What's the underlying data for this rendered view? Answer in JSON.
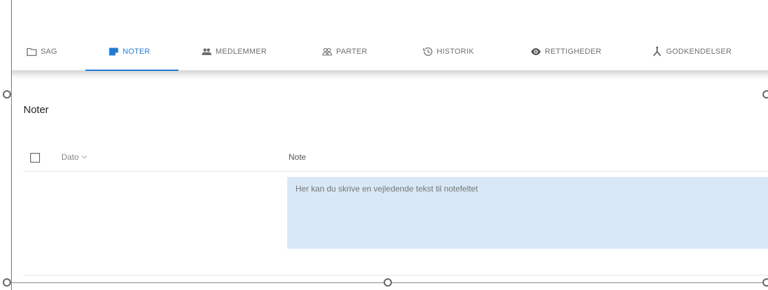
{
  "tabs": [
    {
      "label": "SAG",
      "icon": "folder-icon"
    },
    {
      "label": "NOTER",
      "icon": "note-icon",
      "active": true
    },
    {
      "label": "MEDLEMMER",
      "icon": "group-icon"
    },
    {
      "label": "PARTER",
      "icon": "people-outline-icon"
    },
    {
      "label": "HISTORIK",
      "icon": "history-icon"
    },
    {
      "label": "RETTIGHEDER",
      "icon": "eye-icon"
    },
    {
      "label": "GODKENDELSER",
      "icon": "merge-icon"
    }
  ],
  "section": {
    "title": "Noter"
  },
  "table": {
    "columns": [
      {
        "label": "Dato",
        "sortable": true
      },
      {
        "label": "Note"
      }
    ],
    "note_placeholder": "Her kan du skrive en vejledende tekst til notefeltet"
  },
  "colors": {
    "accent": "#1f7ad6",
    "note_background": "#d8e8f6"
  }
}
